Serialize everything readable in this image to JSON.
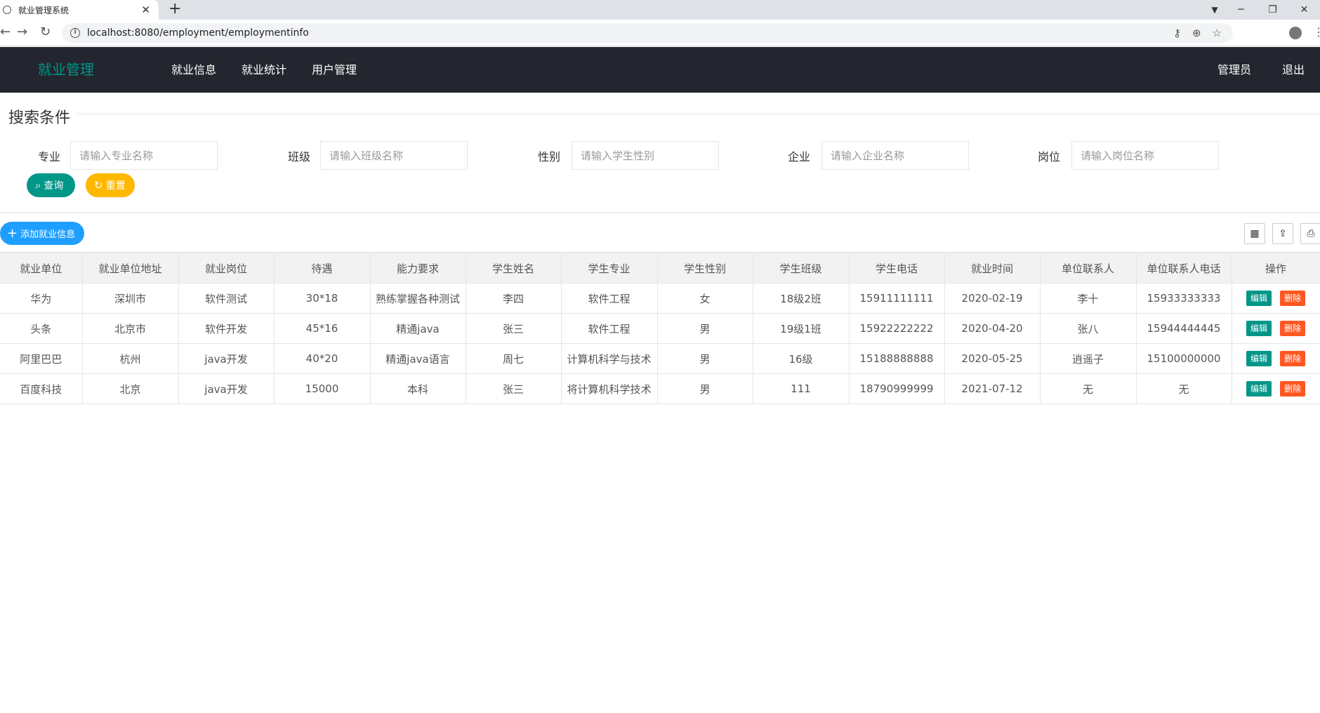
{
  "browser": {
    "tab_title": "就业管理系统",
    "tab_close": "✕",
    "new_tab": "+",
    "url": "localhost:8080/employment/employmentinfo",
    "win_min": "─",
    "win_restore": "❐",
    "win_close": "✕",
    "back": "←",
    "forward": "→",
    "reload": "↻"
  },
  "header": {
    "logo": "就业管理",
    "nav": [
      "就业信息",
      "就业统计",
      "用户管理"
    ],
    "user": "管理员",
    "logout": "退出"
  },
  "search": {
    "legend": "搜索条件",
    "fields": [
      {
        "label": "专业",
        "placeholder": "请输入专业名称"
      },
      {
        "label": "班级",
        "placeholder": "请输入班级名称"
      },
      {
        "label": "性别",
        "placeholder": "请输入学生性别"
      },
      {
        "label": "企业",
        "placeholder": "请输入企业名称"
      },
      {
        "label": "岗位",
        "placeholder": "请输入岗位名称"
      }
    ],
    "query_label": "查询",
    "reset_label": "重置"
  },
  "toolbar": {
    "add_label": "添加就业信息"
  },
  "table": {
    "columns": [
      "就业单位",
      "就业单位地址",
      "就业岗位",
      "待遇",
      "能力要求",
      "学生姓名",
      "学生专业",
      "学生性别",
      "学生班级",
      "学生电话",
      "就业时间",
      "单位联系人",
      "单位联系人电话",
      "操作"
    ],
    "rows": [
      [
        "华为",
        "深圳市",
        "软件测试",
        "30*18",
        "熟练掌握各种测试",
        "李四",
        "软件工程",
        "女",
        "18级2班",
        "15911111111",
        "2020-02-19",
        "李十",
        "15933333333"
      ],
      [
        "头条",
        "北京市",
        "软件开发",
        "45*16",
        "精通java",
        "张三",
        "软件工程",
        "男",
        "19级1班",
        "15922222222",
        "2020-04-20",
        "张八",
        "15944444445"
      ],
      [
        "阿里巴巴",
        "杭州",
        "java开发",
        "40*20",
        "精通java语言",
        "周七",
        "计算机科学与技术",
        "男",
        "16级",
        "15188888888",
        "2020-05-25",
        "逍遥子",
        "15100000000"
      ],
      [
        "百度科技",
        "北京",
        "java开发",
        "15000",
        "本科",
        "张三",
        "将计算机科学技术",
        "男",
        "111",
        "18790999999",
        "2021-07-12",
        "无",
        "无"
      ]
    ],
    "edit_label": "编辑",
    "delete_label": "删除"
  }
}
